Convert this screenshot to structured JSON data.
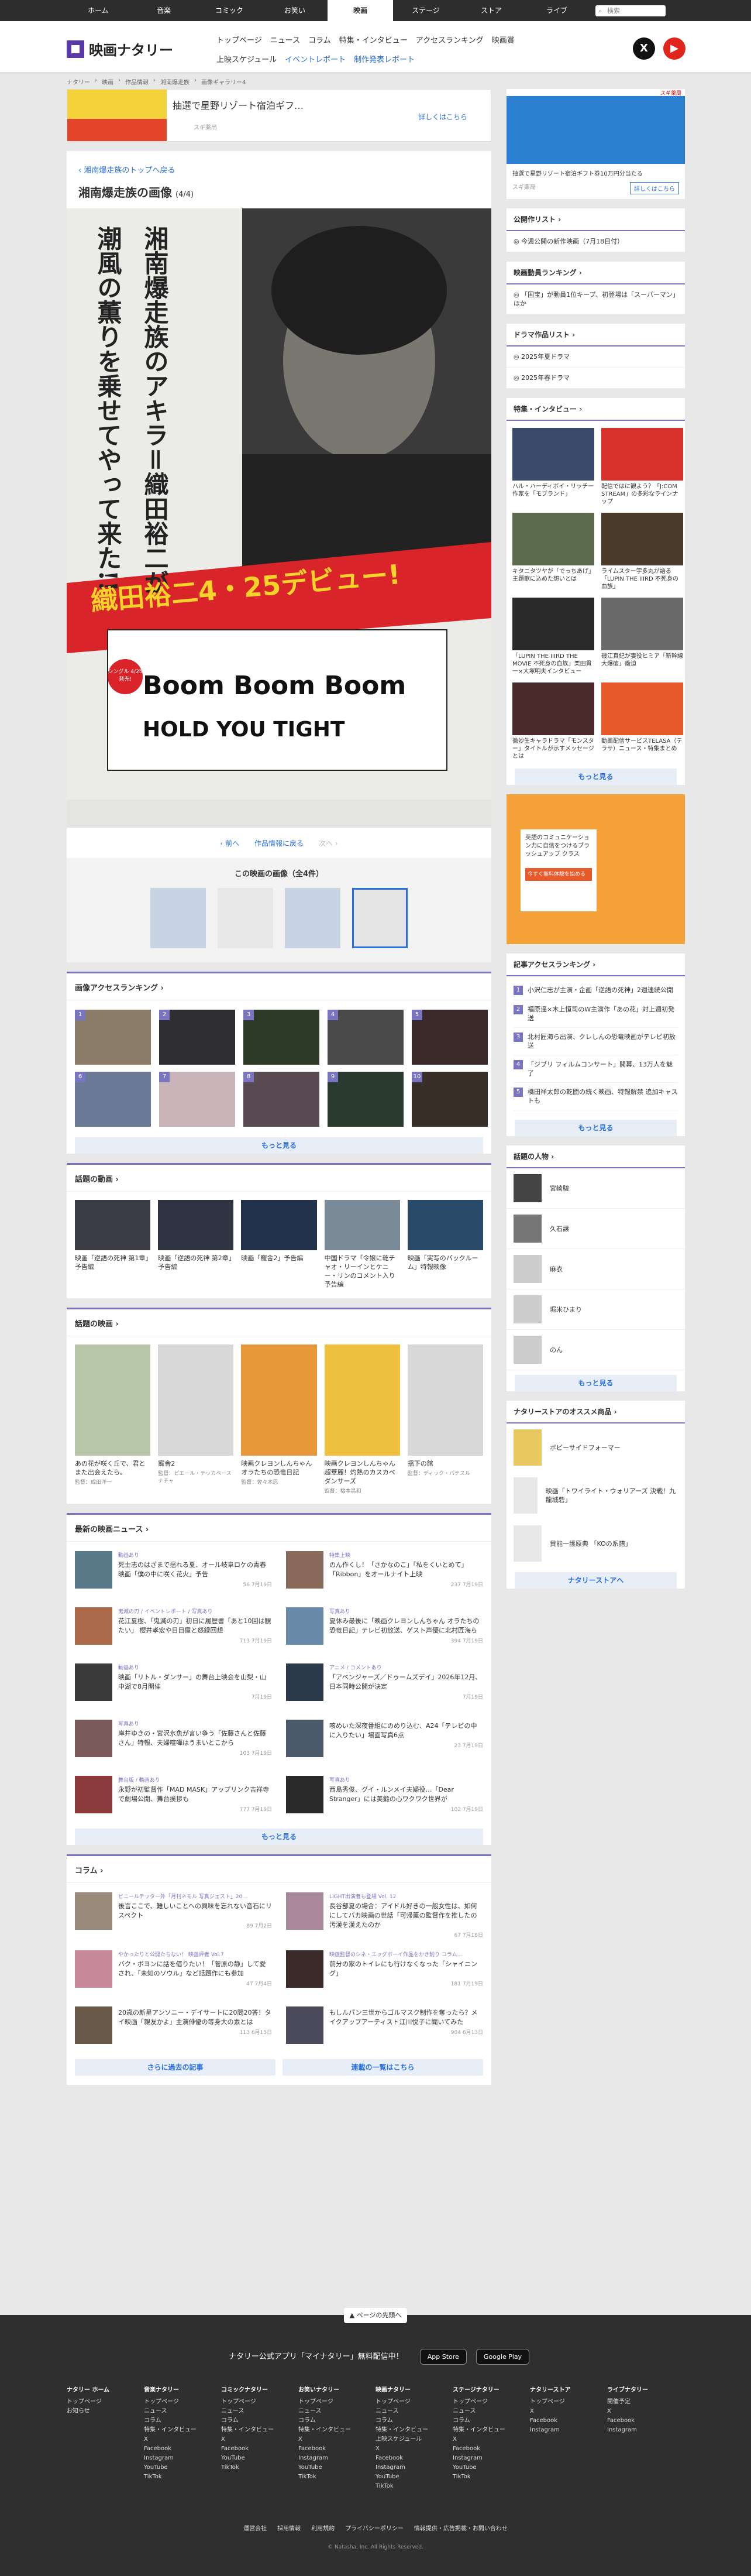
{
  "topnav": {
    "items": [
      "ホーム",
      "音楽",
      "コミック",
      "お笑い",
      "映画",
      "ステージ",
      "ストア",
      "ライブ"
    ],
    "search_placeholder": "検索"
  },
  "header": {
    "logo": "映画ナタリー",
    "subnav_row1": [
      "トップページ",
      "ニュース",
      "コラム",
      "特集・インタビュー",
      "アクセスランキング",
      "映画賞"
    ],
    "subnav_row2": [
      "上映スケジュール",
      "イベントレポート",
      "制作発表レポート"
    ],
    "social": {
      "x": "X",
      "youtube": "▶"
    }
  },
  "breadcrumb": [
    "ナタリー",
    "映画",
    "作品情報",
    "湘南爆走族",
    "画像ギャラリー4"
  ],
  "ad_main": {
    "title": "抽選で星野リゾート宿泊ギフ…",
    "source": "スギ薬局",
    "button": "詳しくはこちら"
  },
  "page": {
    "back_link": "湘南爆走族のトップへ戻る",
    "title": "湘南爆走族の画像",
    "count": "(4/4)",
    "poster_text": {
      "right": "湘南爆走族のアキラ＝織田裕二が",
      "left": "潮風の薫りを乗せてやって来た!!",
      "debut": "織田裕二4・25デビュー!",
      "song1": "Boom Boom Boom",
      "song2": "HOLD YOU TIGHT",
      "single": "シングル 4/25発売!"
    },
    "pager": {
      "prev": "前へ",
      "back": "作品情報に戻る",
      "next": "次へ"
    },
    "gallery_title": "この映画の画像（全4件）"
  },
  "image_ranking": {
    "title": "画像アクセスランキング",
    "nums": [
      "1",
      "2",
      "3",
      "4",
      "5",
      "6",
      "7",
      "8",
      "9",
      "10"
    ],
    "more": "もっと見る"
  },
  "videos": {
    "title": "話題の動画",
    "items": [
      "映画「逆語の死神 第1章」予告編",
      "映画「逆語の死神 第2章」予告編",
      "映画「寵舎2」予告編",
      "中国ドラマ「令嬢に乾チャオ・リーインとケニー・リンのコメント入り予告編",
      "映画「実写のパックルーム」特報映像"
    ]
  },
  "movies": {
    "title": "話題の映画",
    "items": [
      {
        "title": "あの花が咲く丘で、君とまた出会えたら。",
        "sub": "監督：成田洋一"
      },
      {
        "title": "寵舎2",
        "sub": "監督：ピエール・テッカペースナチャ"
      },
      {
        "title": "映画クレヨンしんちゃん オラたちの恐竜日記",
        "sub": "監督：佐々木忍"
      },
      {
        "title": "映画クレヨンしんちゃん 超華麗！灼熱のカスカベダンサーズ",
        "sub": "監督：橋本昌和"
      },
      {
        "title": "揺下の館",
        "sub": "監督：ディック・パテスル"
      }
    ]
  },
  "news": {
    "title": "最新の映画ニュース",
    "items": [
      {
        "tag": "動画あり",
        "title": "死士志のはざまで揺れる夏、オール岐阜ロケの青春映画「僕の中に咲く花火」予告",
        "meta": "56 7月19日"
      },
      {
        "tag": "特集上映",
        "title": "のん作くし！「さかなのこ」「私をくいとめて」「Ribbon」をオールナイト上映",
        "meta": "237 7月19日"
      },
      {
        "tag": "鬼滅の刃 / イベントレポート / 写真あり",
        "title": "花江夏樹、「鬼滅の刃」初日に履歴書「あと10回は観たい」 櫻井孝宏や日目屋と怒録回想",
        "meta": "713 7月19日"
      },
      {
        "tag": "写真あり",
        "title": "夏休み最後に「映画クレヨンしんちゃん オラたちの恐竜日記」テレビ初放送、ゲスト声優に北村匠海ら",
        "meta": "394 7月19日"
      },
      {
        "tag": "動画あり",
        "title": "映画「リトル・ダンサー」の舞台上映会を山梨・山中湖で8月開催",
        "meta": "7月19日"
      },
      {
        "tag": "アニメ / コメントあり",
        "title": "「アベンジャーズ／ドゥームズデイ」2026年12月、日本同時公開が決定",
        "meta": "7月19日"
      },
      {
        "tag": "写真あり",
        "title": "岸井ゆきの・宮沢氷魚が言い争う「佐藤さんと佐藤さん」特報、夫婦喧嘩はうまいとこから",
        "meta": "103 7月19日"
      },
      {
        "tag": "",
        "title": "咳めいた深夜番組にのめり込む、A24「テレビの中に入りたい」場面写真6点",
        "meta": "23 7月19日"
      },
      {
        "tag": "舞台版 / 動画あり",
        "title": "永野が初監督作「MAD MASK」アップリンク吉祥寺で劇場公開、舞台挨拶も",
        "meta": "777 7月19日"
      },
      {
        "tag": "写真あり",
        "title": "西島秀俊、グイ・ルンメイ夫婦役…「Dear Stranger」には美鍛の心ワクワク世界が",
        "meta": "102 7月19日"
      }
    ],
    "more": "もっと見る"
  },
  "columns": {
    "title": "コラム",
    "items": [
      {
        "tag": "ビニールテッター外「月刊ネモル 写真ジェスト」20…",
        "title": "後言ここで、難しいことへの興味を忘れない音石にリスペクト",
        "meta": "89 7月2日"
      },
      {
        "tag": "LIGHT出演者も登場 Vol. 12",
        "title": "長谷部夏の場合：アイドル好きの一般女性は、如何にしてバカ映画の世話「可帰薫の監督作を推したの汚漢を漢えたのか",
        "meta": "67 7月18日"
      },
      {
        "tag": "やかったりと公開たちない！ 映画評者 Vol.7",
        "title": "バク・ボヨンに話を借りたい！「菅原の静」して愛され、「未知のソウル」など話題作にも参加",
        "meta": "47 7月4日"
      },
      {
        "tag": "映画監督のシネ・エッグボーイ作品をかき削り コラム…",
        "title": "前分の家のトイレにも行けなくなった「シャイニング」",
        "meta": "181 7月19日"
      },
      {
        "tag": "",
        "title": "20歳の新星アンソニー・デイサートに20問20答！タイ映画「親友かよ」主演俳優の等身大の素とは",
        "meta": "113 6月15日"
      },
      {
        "tag": "",
        "title": "もしルパン三世からゴルマスク制作を奪ったら？メイクアップアーティスト江川悦子に聞いてみた",
        "meta": "904 6月13日"
      }
    ],
    "btn_left": "さらに過去の記事",
    "btn_right": "連載の一覧はこちら"
  },
  "sidebar": {
    "ad": {
      "source": "スギ薬局",
      "caption": "抽選で星野リゾート宿泊ギフト券10万円分当たる",
      "button": "詳しくはこちら"
    },
    "release_list": {
      "title": "公開作リスト",
      "items": [
        "今週公開の新作映画（7月18日付）"
      ]
    },
    "ranking": {
      "title": "映画動員ランキング",
      "items": [
        "「国宝」が動員1位キープ、初登場は「スーパーマン」ほか"
      ]
    },
    "drama": {
      "title": "ドラマ作品リスト",
      "items": [
        "2025年夏ドラマ",
        "2025年春ドラマ"
      ]
    },
    "features": {
      "title": "特集・インタビュー",
      "items": [
        "ハル・ハーディボイ・リッチー作家を「モブランド」",
        "配信ではに観よう？「J:COM STREAM」の多彩なラインナップ",
        "キタニタツヤが「でっちあげ」主題歌に込めた想いとは",
        "ライムスター宇多丸が語る「LUPIN THE IIIRD 不死身の血族」",
        "「LUPIN THE IIIRD THE MOVIE 不死身の血族」栗田貫一×大塚明夫インタビュー",
        "磯江真紀が妻役ヒミア「新幹線大爆破」衝迫",
        "微妙生キャラドラマ「モンスター」タイトルが示すメッセージとは",
        "動画配信サービスTELASA（テラサ）ニュース・特集まとめ"
      ],
      "more": "もっと見る"
    },
    "ad2": {
      "text": "英語のコミュニケーション力に自信をつけるブラッシュアップ クラス",
      "button": "今すぐ無料体験を始める"
    },
    "article_ranking": {
      "title": "記事アクセスランキング",
      "items": [
        "小沢仁志が主演・企画「逆語の死神」2週連続公開",
        "福原遥×木上恒司のW主演作「あの花」対上週初発送",
        "北村匠海ら出演、クレしんの恐竜映画がテレビ初放送",
        "「ジブリ フィルムコンサート」開幕、13万人を魅了",
        "橋田祥太郎の乾闘の続く映画、特報解禁 追加キャストも"
      ],
      "more": "もっと見る"
    },
    "people": {
      "title": "話題の人物",
      "items": [
        "宮崎駿",
        "久石譲",
        "麻衣",
        "堀米ひまり",
        "のん"
      ],
      "more": "もっと見る"
    },
    "store": {
      "title": "ナタリーストアのオススメ商品",
      "items": [
        "ボビーサイドフォーマー",
        "映画「トワイライト・ウォリアーズ 決戦！九龍城砦」",
        "異能一護原典 「KOの系譜」"
      ],
      "button": "ナタリーストアへ"
    }
  },
  "footer": {
    "top_link": "ページの先頭へ",
    "app_text": "ナタリー公式アプリ「マイナタリー」無料配信中！",
    "app_store": "App Store",
    "google_play": "Google Play",
    "cols": [
      {
        "title": "ナタリー ホーム",
        "links": [
          "トップページ",
          "お知らせ"
        ]
      },
      {
        "title": "音楽ナタリー",
        "links": [
          "トップページ",
          "ニュース",
          "コラム",
          "特集・インタビュー",
          "X",
          "Facebook",
          "Instagram",
          "YouTube",
          "TikTok"
        ]
      },
      {
        "title": "コミックナタリー",
        "links": [
          "トップページ",
          "ニュース",
          "コラム",
          "特集・インタビュー",
          "X",
          "Facebook",
          "YouTube",
          "TikTok"
        ]
      },
      {
        "title": "お笑いナタリー",
        "links": [
          "トップページ",
          "ニュース",
          "コラム",
          "特集・インタビュー",
          "X",
          "Facebook",
          "Instagram",
          "YouTube",
          "TikTok"
        ]
      },
      {
        "title": "映画ナタリー",
        "links": [
          "トップページ",
          "ニュース",
          "コラム",
          "特集・インタビュー",
          "上映スケジュール",
          "X",
          "Facebook",
          "Instagram",
          "YouTube",
          "TikTok"
        ]
      },
      {
        "title": "ステージナタリー",
        "links": [
          "トップページ",
          "ニュース",
          "コラム",
          "特集・インタビュー",
          "X",
          "Facebook",
          "Instagram",
          "YouTube",
          "TikTok"
        ]
      },
      {
        "title": "ナタリーストア",
        "links": [
          "トップページ",
          "X",
          "Facebook",
          "Instagram"
        ]
      },
      {
        "title": "ライブナタリー",
        "links": [
          "開催予定",
          "X",
          "Facebook",
          "Instagram"
        ]
      }
    ],
    "links": [
      "運営会社",
      "採用情報",
      "利用規約",
      "プライバシーポリシー",
      "情報提供・広告掲載・お問い合わせ"
    ],
    "copyright": "© Natasha, Inc. All Rights Reserved."
  }
}
